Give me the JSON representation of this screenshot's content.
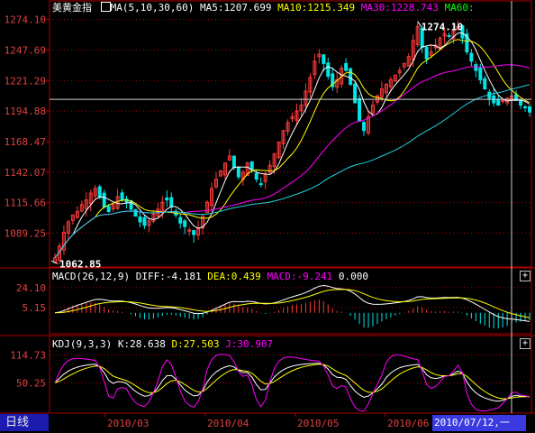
{
  "header": {
    "instrument": "美黄金指",
    "ma_params": "MA(5,10,30,60)",
    "ma5": "MA5:1207.699",
    "ma10": "MA10:1215.349",
    "ma30": "MA30:1228.743",
    "ma60": "MA60:"
  },
  "macd_header": {
    "label": "MACD(26,12,9)",
    "diff": "DIFF:-4.181",
    "dea": "DEA:0.439",
    "macd": "MACD:-9.241",
    "extra": "0.000"
  },
  "kdj_header": {
    "label": "KDJ(9,3,3)",
    "k": "K:28.638",
    "d": "D:27.503",
    "j": "J:30.907"
  },
  "price_axis": [
    "1274.10",
    "1247.69",
    "1221.29",
    "1194.88",
    "1168.47",
    "1142.07",
    "1115.66",
    "1089.25"
  ],
  "macd_axis": [
    "24.10",
    "5.15"
  ],
  "kdj_axis": [
    "114.73",
    "50.25"
  ],
  "time_axis": [
    "2010/03",
    "2010/04",
    "2010/05",
    "2010/06"
  ],
  "annotations": {
    "high": "1274.10",
    "low": "1062.85"
  },
  "bottom": {
    "period": "日线",
    "cursor_date": "2010/07/12,一"
  },
  "close_icon_glyph": "+",
  "colors": {
    "bg": "#000000",
    "axis": "#b00000",
    "up": "#ff3b3b",
    "down": "#00e5e5",
    "ma5": "#ffffff",
    "ma10": "#ffff00",
    "ma30": "#ff00ff",
    "ma60": "#00ff00",
    "kline_ma60": "#22d3e0",
    "cursor": "#d0d0d0",
    "tab": "#1b1bb0",
    "date_cursor": "#3a3ae0"
  },
  "chart_data": {
    "type": "candlestick",
    "price_range": [
      1060,
      1280
    ],
    "high": 1274.1,
    "low": 1062.85,
    "close_series": [
      1068,
      1078,
      1090,
      1099,
      1105,
      1108,
      1114,
      1118,
      1124,
      1128,
      1120,
      1112,
      1108,
      1114,
      1121,
      1118,
      1116,
      1110,
      1104,
      1099,
      1096,
      1100,
      1106,
      1110,
      1116,
      1118,
      1112,
      1105,
      1098,
      1095,
      1092,
      1088,
      1094,
      1104,
      1116,
      1128,
      1136,
      1143,
      1150,
      1156,
      1146,
      1138,
      1142,
      1150,
      1144,
      1136,
      1132,
      1140,
      1148,
      1158,
      1168,
      1178,
      1185,
      1190,
      1195,
      1200,
      1212,
      1224,
      1238,
      1244,
      1236,
      1225,
      1216,
      1222,
      1232,
      1230,
      1218,
      1202,
      1186,
      1178,
      1190,
      1200,
      1208,
      1214,
      1218,
      1222,
      1226,
      1230,
      1236,
      1242,
      1256,
      1268,
      1250,
      1240,
      1246,
      1252,
      1258,
      1262,
      1260,
      1264,
      1268,
      1258,
      1246,
      1238,
      1230,
      1222,
      1214,
      1206,
      1202,
      1200,
      1204,
      1206,
      1208,
      1204,
      1200,
      1198,
      1194
    ],
    "macd_range": [
      -20,
      30
    ],
    "kdj_range": [
      -20,
      130
    ]
  }
}
